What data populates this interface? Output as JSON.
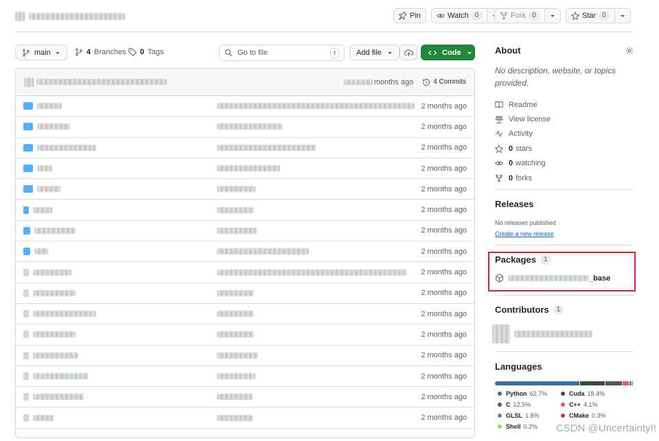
{
  "header": {
    "pin_label": "Pin",
    "watch_label": "Watch",
    "watch_count": "0",
    "fork_label": "Fork",
    "fork_count": "0",
    "star_label": "Star",
    "star_count": "0"
  },
  "toolbar": {
    "branch": "main",
    "branches_count": "4",
    "branches_label": "Branches",
    "tags_count": "0",
    "tags_label": "Tags",
    "search_placeholder": "Go to file",
    "search_shortcut": "t",
    "add_file_label": "Add file",
    "code_label": "Code"
  },
  "commit_bar": {
    "time_suffix": "months ago",
    "commits_label": "4 Commits"
  },
  "files": [
    {
      "age": "2 months ago"
    },
    {
      "age": "2 months ago"
    },
    {
      "age": "2 months ago"
    },
    {
      "age": "2 months ago"
    },
    {
      "age": "2 months ago"
    },
    {
      "age": "2 months ago"
    },
    {
      "age": "2 months ago"
    },
    {
      "age": "2 months ago"
    },
    {
      "age": "2 months ago"
    },
    {
      "age": "2 months ago"
    },
    {
      "age": "2 months ago"
    },
    {
      "age": "2 months ago"
    },
    {
      "age": "2 months ago"
    },
    {
      "age": "2 months ago"
    },
    {
      "age": "2 months ago"
    },
    {
      "age": "2 months ago"
    }
  ],
  "about": {
    "title": "About",
    "description": "No description, website, or topics provided.",
    "readme": "Readme",
    "license": "View license",
    "activity": "Activity",
    "stars_count": "0",
    "stars_label": "stars",
    "watching_count": "0",
    "watching_label": "watching",
    "forks_count": "0",
    "forks_label": "forks"
  },
  "releases": {
    "title": "Releases",
    "none_text": "No releases published",
    "create_link": "Create a new release"
  },
  "packages": {
    "title": "Packages",
    "count": "1",
    "package_suffix": "_base"
  },
  "contributors": {
    "title": "Contributors",
    "count": "1"
  },
  "languages": {
    "title": "Languages",
    "items": [
      {
        "name": "Python",
        "percent": "62.7%",
        "color": "#3572A5"
      },
      {
        "name": "Cuda",
        "percent": "18.4%",
        "color": "#3A4E3A"
      },
      {
        "name": "C",
        "percent": "12.5%",
        "color": "#555555"
      },
      {
        "name": "C++",
        "percent": "4.1%",
        "color": "#f34b7d"
      },
      {
        "name": "GLSL",
        "percent": "1.8%",
        "color": "#5686a5"
      },
      {
        "name": "CMake",
        "percent": "0.3%",
        "color": "#DA3434"
      },
      {
        "name": "Shell",
        "percent": "0.2%",
        "color": "#89e051"
      }
    ]
  },
  "watermark": "CSDN @Uncertainty!!"
}
